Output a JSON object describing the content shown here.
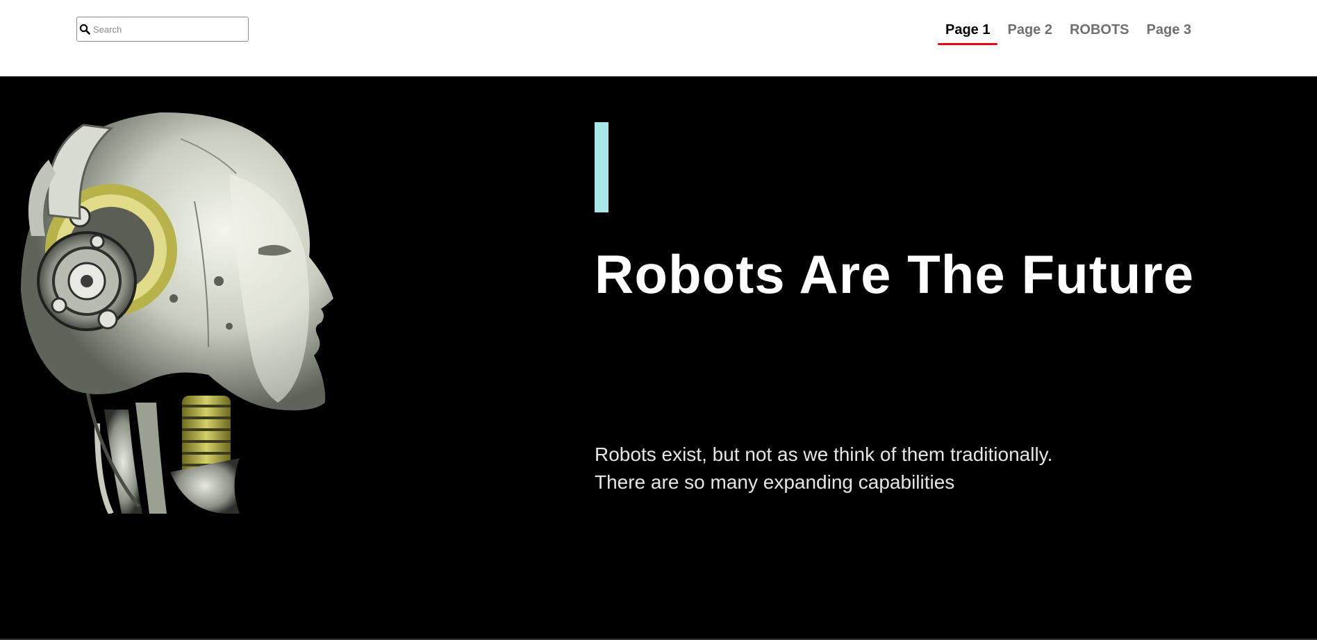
{
  "header": {
    "search": {
      "placeholder": "Search",
      "value": ""
    },
    "nav": [
      {
        "label": "Page 1",
        "active": true
      },
      {
        "label": "Page 2",
        "active": false
      },
      {
        "label": "ROBOTS",
        "active": false
      },
      {
        "label": "Page 3",
        "active": false
      }
    ],
    "active_indicator_color": "#e30613"
  },
  "hero": {
    "background_color": "#000000",
    "accent_bar_color": "#a8e8e8",
    "image": "robot-head-profile",
    "title": "Robots Are The Future",
    "body_lines": [
      "Robots exist, but not as we think of them traditionally.",
      "There are so many expanding capabilities"
    ]
  }
}
